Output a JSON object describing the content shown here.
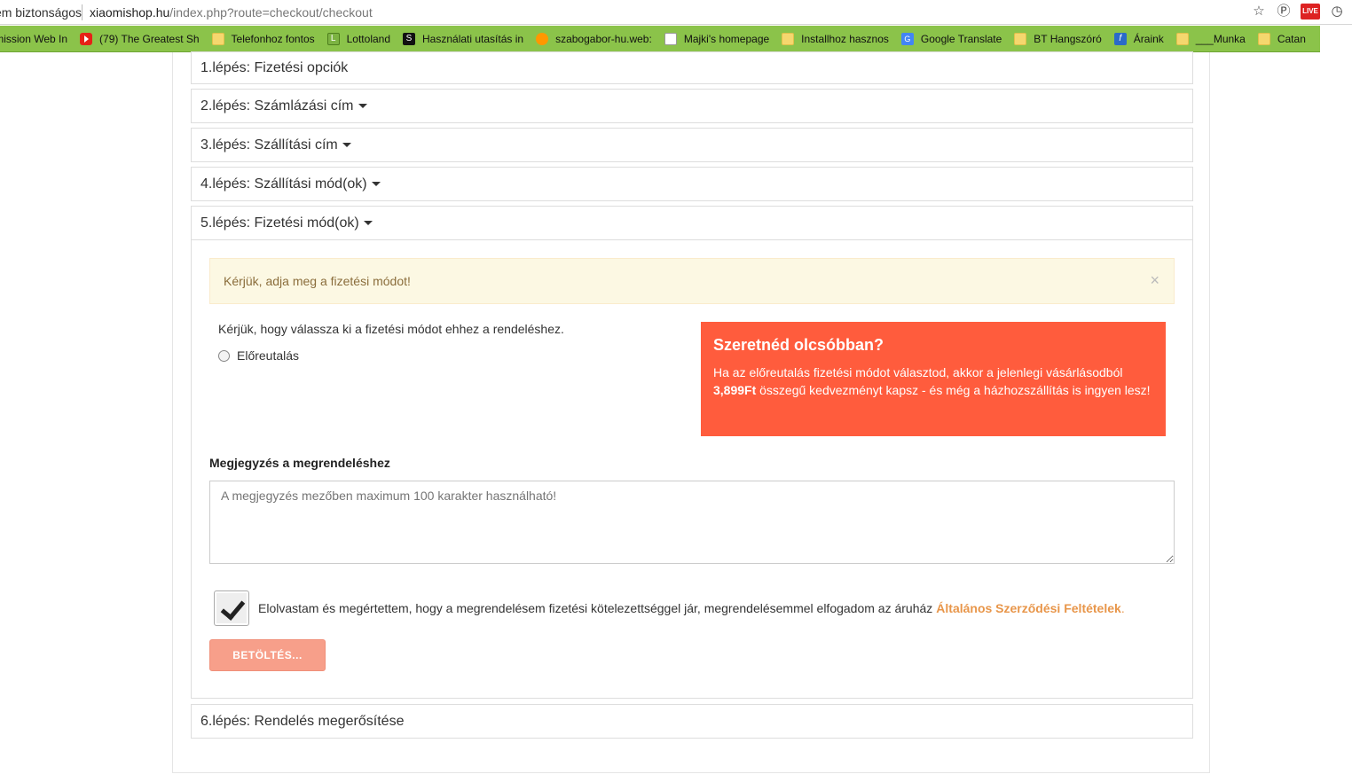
{
  "browser": {
    "secure_label": "Nem biztonságos",
    "url_host": "xiaomishop.hu",
    "url_path": "/index.php?route=checkout/checkout",
    "live_badge": "LIVE",
    "bookmarks": [
      {
        "label": "Transmission Web In",
        "icon": "folder-icon"
      },
      {
        "label": "(79) The Greatest Sh",
        "icon": "youtube-icon"
      },
      {
        "label": "Telefonhoz fontos",
        "icon": "folder-icon"
      },
      {
        "label": "Lottoland",
        "icon": "lottoland-icon"
      },
      {
        "label": "Használati utasítás in",
        "icon": "s-icon"
      },
      {
        "label": "szabogabor-hu.web:",
        "icon": "owl-icon"
      },
      {
        "label": "Majki's homepage",
        "icon": "document-icon"
      },
      {
        "label": "Installhoz hasznos",
        "icon": "folder-icon"
      },
      {
        "label": "Google Translate",
        "icon": "google-translate-icon"
      },
      {
        "label": "BT Hangszóró",
        "icon": "folder-icon"
      },
      {
        "label": "Áraink",
        "icon": "f-icon"
      },
      {
        "label": "___Munka",
        "icon": "folder-icon"
      },
      {
        "label": "Catan",
        "icon": "folder-icon"
      }
    ]
  },
  "steps": {
    "step1": "1.lépés: Fizetési opciók",
    "step2": "2.lépés: Számlázási cím",
    "step3": "3.lépés: Szállítási cím",
    "step4": "4.lépés: Szállítási mód(ok)",
    "step5": "5.lépés: Fizetési mód(ok)",
    "step6": "6.lépés: Rendelés megerősítése"
  },
  "payment": {
    "alert": "Kérjük, adja meg a fizetési módot!",
    "alert_close": "×",
    "instruction": "Kérjük, hogy válassza ki a fizetési módot ehhez a rendeléshez.",
    "option_label": "Előreutalás",
    "option_selected": false
  },
  "promo": {
    "title": "Szeretnéd olcsóbban?",
    "text_before": "Ha az előreutalás fizetési módot választod, akkor a jelenlegi vásárlásodból ",
    "amount": "3,899Ft",
    "text_after": " összegű kedvezményt kapsz - és még a házhozszállítás is ingyen lesz!"
  },
  "note": {
    "label": "Megjegyzés a megrendeléshez",
    "placeholder": "A megjegyzés mezőben maximum 100 karakter használható!"
  },
  "terms": {
    "checked": true,
    "text": "Elolvastam és megértettem, hogy a megrendelésem fizetési kötelezettséggel jár, megrendelésemmel elfogadom az áruház",
    "link": "Általános Szerződési Feltételek",
    "link_suffix": "."
  },
  "button": {
    "label": "BETÖLTÉS..."
  },
  "colors": {
    "bookmark_bar": "#8bc34a",
    "promo_bg": "#ff5c3d",
    "alert_bg": "#fcf8e3",
    "link": "#e8964a",
    "button_bg": "#f79f8a"
  }
}
